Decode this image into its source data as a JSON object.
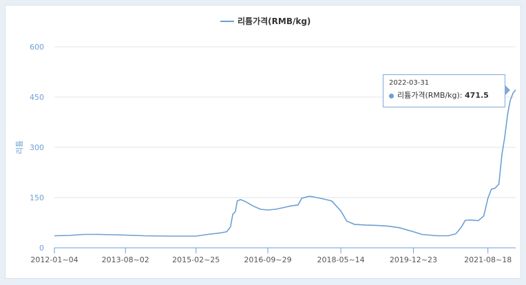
{
  "chart_data": {
    "type": "line",
    "legend": "리튬가격(RMB/kg)",
    "legend_position": "top-center",
    "ylabel": "리튬",
    "xlabel": "",
    "ylim": [
      0,
      600
    ],
    "yticks": [
      0,
      150,
      300,
      450,
      600
    ],
    "xticks": [
      "2012-01-04",
      "2013-08-02",
      "2015-02-25",
      "2016-09-29",
      "2018-05-14",
      "2019-12-23",
      "2021-08-18"
    ],
    "grid": "horizontal",
    "color": "#6a9fd4",
    "series": [
      {
        "name": "리튬가격(RMB/kg)",
        "points": [
          [
            "2012-01-04",
            36
          ],
          [
            "2012-05-01",
            37
          ],
          [
            "2012-09-01",
            40
          ],
          [
            "2013-01-01",
            40
          ],
          [
            "2013-08-02",
            38
          ],
          [
            "2014-01-01",
            36
          ],
          [
            "2014-08-01",
            35
          ],
          [
            "2015-02-25",
            35
          ],
          [
            "2015-06-01",
            40
          ],
          [
            "2015-09-01",
            44
          ],
          [
            "2015-11-01",
            48
          ],
          [
            "2015-12-01",
            62
          ],
          [
            "2015-12-20",
            100
          ],
          [
            "2016-01-10",
            108
          ],
          [
            "2016-01-25",
            140
          ],
          [
            "2016-02-20",
            144
          ],
          [
            "2016-04-01",
            138
          ],
          [
            "2016-06-01",
            125
          ],
          [
            "2016-08-01",
            115
          ],
          [
            "2016-09-29",
            113
          ],
          [
            "2016-12-01",
            115
          ],
          [
            "2017-02-01",
            120
          ],
          [
            "2017-04-01",
            125
          ],
          [
            "2017-06-01",
            128
          ],
          [
            "2017-07-01",
            148
          ],
          [
            "2017-09-01",
            154
          ],
          [
            "2017-11-01",
            150
          ],
          [
            "2018-01-01",
            145
          ],
          [
            "2018-03-01",
            140
          ],
          [
            "2018-05-14",
            110
          ],
          [
            "2018-07-01",
            80
          ],
          [
            "2018-09-01",
            70
          ],
          [
            "2018-12-01",
            68
          ],
          [
            "2019-03-01",
            67
          ],
          [
            "2019-06-01",
            65
          ],
          [
            "2019-09-01",
            60
          ],
          [
            "2019-12-23",
            48
          ],
          [
            "2020-03-01",
            40
          ],
          [
            "2020-07-01",
            36
          ],
          [
            "2020-10-01",
            36
          ],
          [
            "2020-12-01",
            42
          ],
          [
            "2021-01-15",
            62
          ],
          [
            "2021-02-15",
            82
          ],
          [
            "2021-04-01",
            83
          ],
          [
            "2021-06-01",
            81
          ],
          [
            "2021-07-15",
            95
          ],
          [
            "2021-08-18",
            148
          ],
          [
            "2021-09-15",
            175
          ],
          [
            "2021-10-15",
            178
          ],
          [
            "2021-11-15",
            190
          ],
          [
            "2021-12-10",
            280
          ],
          [
            "2022-01-01",
            330
          ],
          [
            "2022-01-25",
            400
          ],
          [
            "2022-02-15",
            440
          ],
          [
            "2022-03-10",
            462
          ],
          [
            "2022-03-31",
            471.5
          ]
        ]
      }
    ],
    "tooltip": {
      "date": "2022-03-31",
      "label": "리튬가격(RMB/kg): ",
      "value": "471.5"
    }
  }
}
